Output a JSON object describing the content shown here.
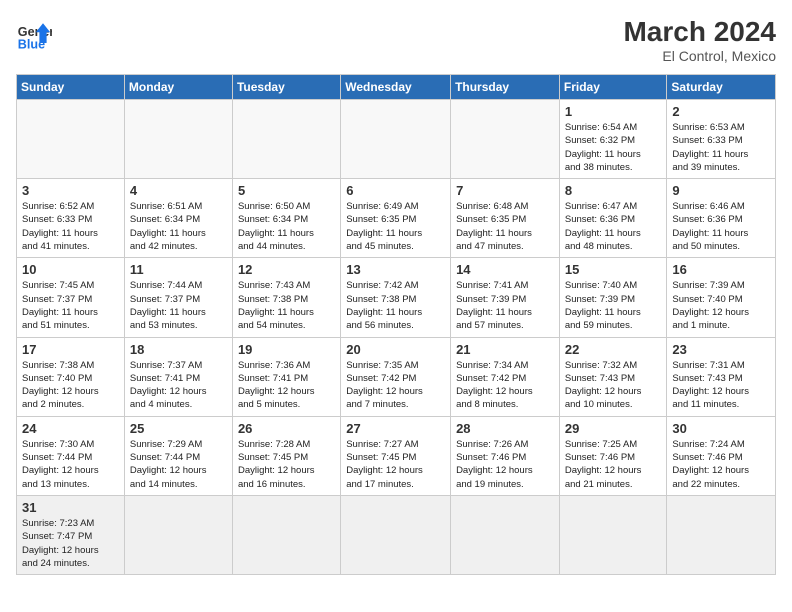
{
  "header": {
    "logo_general": "General",
    "logo_blue": "Blue",
    "month_year": "March 2024",
    "location": "El Control, Mexico"
  },
  "days_of_week": [
    "Sunday",
    "Monday",
    "Tuesday",
    "Wednesday",
    "Thursday",
    "Friday",
    "Saturday"
  ],
  "weeks": [
    [
      {
        "day": "",
        "info": ""
      },
      {
        "day": "",
        "info": ""
      },
      {
        "day": "",
        "info": ""
      },
      {
        "day": "",
        "info": ""
      },
      {
        "day": "",
        "info": ""
      },
      {
        "day": "1",
        "info": "Sunrise: 6:54 AM\nSunset: 6:32 PM\nDaylight: 11 hours\nand 38 minutes."
      },
      {
        "day": "2",
        "info": "Sunrise: 6:53 AM\nSunset: 6:33 PM\nDaylight: 11 hours\nand 39 minutes."
      }
    ],
    [
      {
        "day": "3",
        "info": "Sunrise: 6:52 AM\nSunset: 6:33 PM\nDaylight: 11 hours\nand 41 minutes."
      },
      {
        "day": "4",
        "info": "Sunrise: 6:51 AM\nSunset: 6:34 PM\nDaylight: 11 hours\nand 42 minutes."
      },
      {
        "day": "5",
        "info": "Sunrise: 6:50 AM\nSunset: 6:34 PM\nDaylight: 11 hours\nand 44 minutes."
      },
      {
        "day": "6",
        "info": "Sunrise: 6:49 AM\nSunset: 6:35 PM\nDaylight: 11 hours\nand 45 minutes."
      },
      {
        "day": "7",
        "info": "Sunrise: 6:48 AM\nSunset: 6:35 PM\nDaylight: 11 hours\nand 47 minutes."
      },
      {
        "day": "8",
        "info": "Sunrise: 6:47 AM\nSunset: 6:36 PM\nDaylight: 11 hours\nand 48 minutes."
      },
      {
        "day": "9",
        "info": "Sunrise: 6:46 AM\nSunset: 6:36 PM\nDaylight: 11 hours\nand 50 minutes."
      }
    ],
    [
      {
        "day": "10",
        "info": "Sunrise: 7:45 AM\nSunset: 7:37 PM\nDaylight: 11 hours\nand 51 minutes."
      },
      {
        "day": "11",
        "info": "Sunrise: 7:44 AM\nSunset: 7:37 PM\nDaylight: 11 hours\nand 53 minutes."
      },
      {
        "day": "12",
        "info": "Sunrise: 7:43 AM\nSunset: 7:38 PM\nDaylight: 11 hours\nand 54 minutes."
      },
      {
        "day": "13",
        "info": "Sunrise: 7:42 AM\nSunset: 7:38 PM\nDaylight: 11 hours\nand 56 minutes."
      },
      {
        "day": "14",
        "info": "Sunrise: 7:41 AM\nSunset: 7:39 PM\nDaylight: 11 hours\nand 57 minutes."
      },
      {
        "day": "15",
        "info": "Sunrise: 7:40 AM\nSunset: 7:39 PM\nDaylight: 11 hours\nand 59 minutes."
      },
      {
        "day": "16",
        "info": "Sunrise: 7:39 AM\nSunset: 7:40 PM\nDaylight: 12 hours\nand 1 minute."
      }
    ],
    [
      {
        "day": "17",
        "info": "Sunrise: 7:38 AM\nSunset: 7:40 PM\nDaylight: 12 hours\nand 2 minutes."
      },
      {
        "day": "18",
        "info": "Sunrise: 7:37 AM\nSunset: 7:41 PM\nDaylight: 12 hours\nand 4 minutes."
      },
      {
        "day": "19",
        "info": "Sunrise: 7:36 AM\nSunset: 7:41 PM\nDaylight: 12 hours\nand 5 minutes."
      },
      {
        "day": "20",
        "info": "Sunrise: 7:35 AM\nSunset: 7:42 PM\nDaylight: 12 hours\nand 7 minutes."
      },
      {
        "day": "21",
        "info": "Sunrise: 7:34 AM\nSunset: 7:42 PM\nDaylight: 12 hours\nand 8 minutes."
      },
      {
        "day": "22",
        "info": "Sunrise: 7:32 AM\nSunset: 7:43 PM\nDaylight: 12 hours\nand 10 minutes."
      },
      {
        "day": "23",
        "info": "Sunrise: 7:31 AM\nSunset: 7:43 PM\nDaylight: 12 hours\nand 11 minutes."
      }
    ],
    [
      {
        "day": "24",
        "info": "Sunrise: 7:30 AM\nSunset: 7:44 PM\nDaylight: 12 hours\nand 13 minutes."
      },
      {
        "day": "25",
        "info": "Sunrise: 7:29 AM\nSunset: 7:44 PM\nDaylight: 12 hours\nand 14 minutes."
      },
      {
        "day": "26",
        "info": "Sunrise: 7:28 AM\nSunset: 7:45 PM\nDaylight: 12 hours\nand 16 minutes."
      },
      {
        "day": "27",
        "info": "Sunrise: 7:27 AM\nSunset: 7:45 PM\nDaylight: 12 hours\nand 17 minutes."
      },
      {
        "day": "28",
        "info": "Sunrise: 7:26 AM\nSunset: 7:46 PM\nDaylight: 12 hours\nand 19 minutes."
      },
      {
        "day": "29",
        "info": "Sunrise: 7:25 AM\nSunset: 7:46 PM\nDaylight: 12 hours\nand 21 minutes."
      },
      {
        "day": "30",
        "info": "Sunrise: 7:24 AM\nSunset: 7:46 PM\nDaylight: 12 hours\nand 22 minutes."
      }
    ],
    [
      {
        "day": "31",
        "info": "Sunrise: 7:23 AM\nSunset: 7:47 PM\nDaylight: 12 hours\nand 24 minutes."
      },
      {
        "day": "",
        "info": ""
      },
      {
        "day": "",
        "info": ""
      },
      {
        "day": "",
        "info": ""
      },
      {
        "day": "",
        "info": ""
      },
      {
        "day": "",
        "info": ""
      },
      {
        "day": "",
        "info": ""
      }
    ]
  ]
}
